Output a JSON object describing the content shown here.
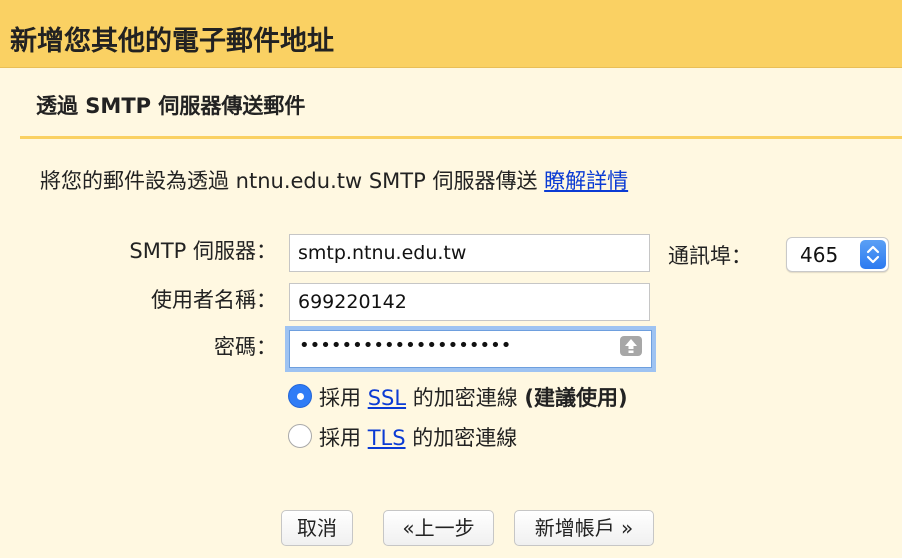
{
  "header": {
    "title": "新增您其他的電子郵件地址"
  },
  "section": {
    "title": "透過 SMTP 伺服器傳送郵件"
  },
  "intro": {
    "text": "將您的郵件設為透過 ntnu.edu.tw SMTP 伺服器傳送",
    "link": "瞭解詳情"
  },
  "form": {
    "smtp_label": "SMTP 伺服器：",
    "smtp_value": "smtp.ntnu.edu.tw",
    "port_label": "通訊埠：",
    "port_value": "465",
    "username_label": "使用者名稱：",
    "username_value": "699220142",
    "password_label": "密碼：",
    "password_masked": "••••••••••••••••••••"
  },
  "security": {
    "ssl": {
      "prefix": "採用 ",
      "link": "SSL",
      "suffix": " 的加密連線 ",
      "note": "(建議使用)",
      "selected": true
    },
    "tls": {
      "prefix": "採用 ",
      "link": "TLS",
      "suffix": " 的加密連線",
      "selected": false
    }
  },
  "buttons": {
    "cancel": "取消",
    "back": "«上一步",
    "add_account": "新增帳戶 »"
  },
  "colors": {
    "header_bg": "#fad163",
    "page_bg": "#fff8e1",
    "link": "#0b3bd4",
    "radio_on": "#2f7cf6"
  },
  "icons": {
    "password_key": "key-up-arrow-icon",
    "port_stepper": "chevron-up-down-icon"
  }
}
